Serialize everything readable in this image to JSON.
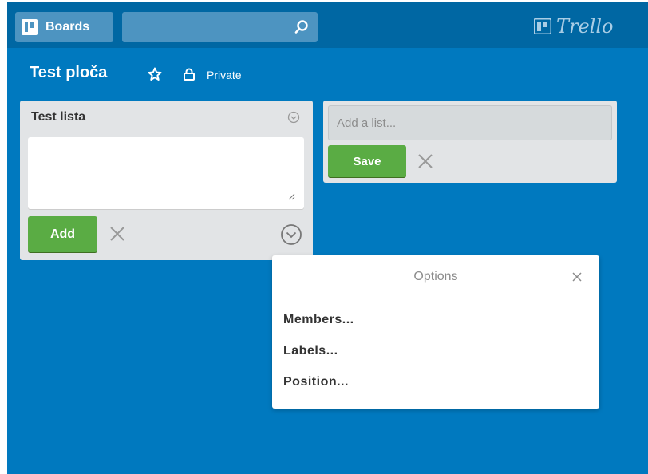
{
  "header": {
    "boards_label": "Boards",
    "search_value": "",
    "logo_text": "Trello"
  },
  "board": {
    "title": "Test ploča",
    "privacy_label": "Private"
  },
  "list": {
    "title": "Test lista",
    "card_textarea_value": "",
    "add_label": "Add"
  },
  "add_list": {
    "placeholder": "Add a list...",
    "save_label": "Save"
  },
  "popover": {
    "title": "Options",
    "items": [
      {
        "label": "Members..."
      },
      {
        "label": "Labels..."
      },
      {
        "label": "Position..."
      }
    ]
  },
  "colors": {
    "board_bg": "#0079bf",
    "header_bg": "#0067a3",
    "button_green": "#5aac44",
    "list_bg": "#e2e4e6"
  },
  "icons": [
    "boards-icon",
    "search-icon",
    "trello-logo-icon",
    "star-icon",
    "lock-icon",
    "chevron-down-circle-icon",
    "close-icon",
    "resize-grip-icon"
  ]
}
